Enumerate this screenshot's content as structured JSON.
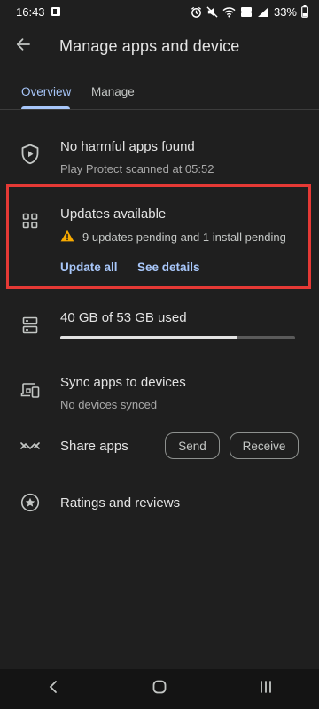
{
  "status_bar": {
    "time": "16:43",
    "battery": "33%"
  },
  "header": {
    "title": "Manage apps and device"
  },
  "tabs": [
    {
      "label": "Overview",
      "active": true
    },
    {
      "label": "Manage",
      "active": false
    }
  ],
  "protect": {
    "title": "No harmful apps found",
    "subtitle": "Play Protect scanned at 05:52"
  },
  "updates": {
    "title": "Updates available",
    "warning": "9 updates pending and 1 install pending",
    "update_all": "Update all",
    "see_details": "See details"
  },
  "storage": {
    "title": "40 GB of 53 GB used",
    "used_fraction": 0.755
  },
  "sync": {
    "title": "Sync apps to devices",
    "subtitle": "No devices synced"
  },
  "share": {
    "title": "Share apps",
    "send": "Send",
    "receive": "Receive"
  },
  "ratings": {
    "title": "Ratings and reviews"
  },
  "colors": {
    "accent": "#a8c7fa",
    "highlight": "#e53935",
    "warning": "#f9ab00"
  }
}
